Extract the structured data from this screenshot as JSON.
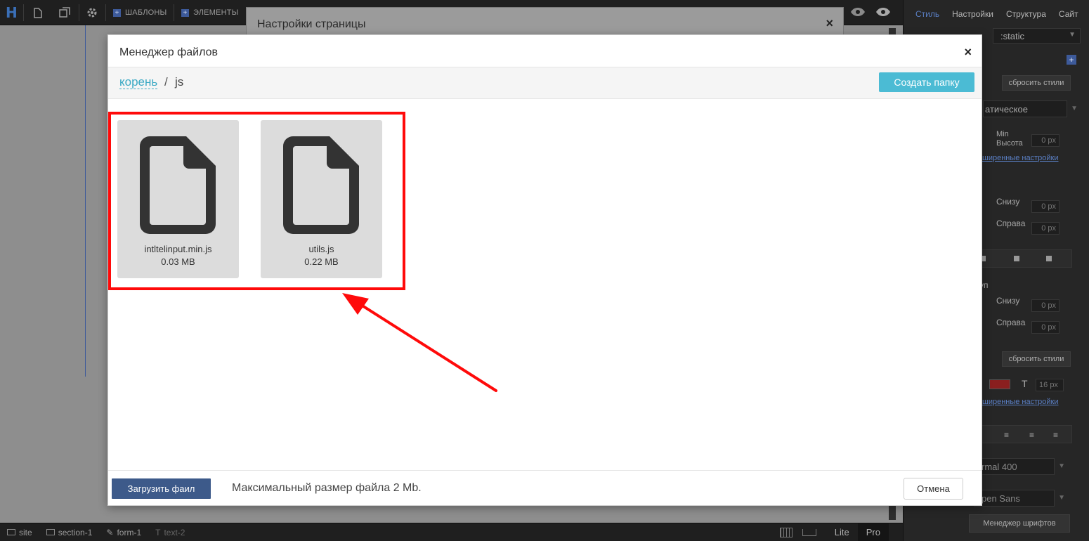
{
  "toolbar": {
    "logo": "H",
    "templates_label": "ШАБЛОНЫ",
    "elements_label": "ЭЛЕМЕНТЫ",
    "plus": "+"
  },
  "right_panel": {
    "tabs": [
      "Стиль",
      "Настройки",
      "Структура",
      "Сайт"
    ],
    "position_value": ":static",
    "reset_styles_1": "сбросить стили",
    "display_value": "атическое",
    "min_height_label": "Min\nВысота",
    "min_height_value": "0",
    "unit_px": "px",
    "advanced_link_1": "ширенные настройки",
    "bottom_label_1": "Снизу",
    "right_label_1": "Справа",
    "margin_group_label": "уп",
    "bottom_label_2": "Снизу",
    "right_label_2": "Справа",
    "zero": "0",
    "reset_styles_2": "сбросить стили",
    "font_size_value": "16",
    "advanced_link_2": "ширенные настройки",
    "font_weight_value": "rmal 400",
    "font_family_value": "pen Sans",
    "font_manager_button": "Менеджер шрифтов"
  },
  "statusbar": {
    "crumbs": [
      "site",
      "section-1",
      "form-1",
      "text-2"
    ],
    "mode_lite": "Lite",
    "mode_pro": "Pro"
  },
  "bg_modal": {
    "title": "Настройки страницы",
    "close": "×"
  },
  "file_manager": {
    "title": "Менеджер файлов",
    "close": "×",
    "breadcrumb_root": "корень",
    "breadcrumb_sep": "/",
    "breadcrumb_current": "js",
    "create_folder_button": "Создать папку",
    "files": [
      {
        "name": "intltelinput.min.js",
        "size": "0.03 MB",
        "icon": "file-icon"
      },
      {
        "name": "utils.js",
        "size": "0.22 MB",
        "icon": "file-icon"
      }
    ],
    "upload_button": "Загрузить фаил",
    "max_size_text": "Максимальный размер файла 2 Mb.",
    "cancel_button": "Отмена"
  },
  "colors": {
    "accent_teal": "#4bbbd4",
    "upload_blue": "#3d5a8a",
    "annotation_red": "#ff0a0a"
  }
}
